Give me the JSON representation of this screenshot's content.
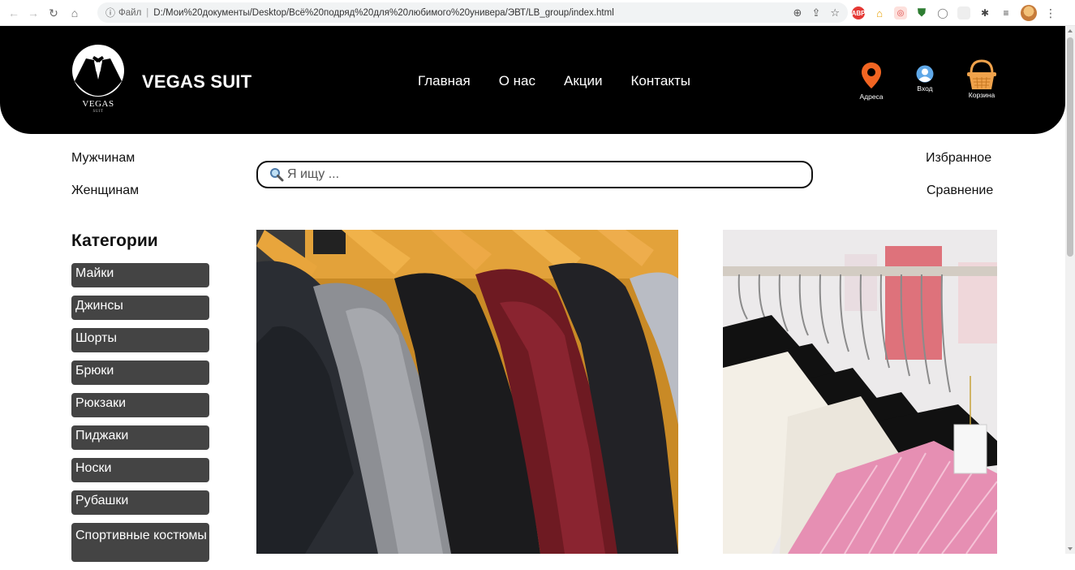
{
  "browser": {
    "scheme_label": "Файл",
    "url": "D:/Мои%20документы/Desktop/Всё%20подряд%20для%20любимого%20универа/ЭВТ/LB_group/index.html"
  },
  "site": {
    "logo_word": "VEGAS",
    "logo_sub": "SUIT",
    "brand": "VEGAS SUIT",
    "nav": [
      {
        "label": "Главная"
      },
      {
        "label": "О нас"
      },
      {
        "label": "Акции"
      },
      {
        "label": "Контакты"
      }
    ],
    "header_icons": {
      "address_label": "Адреса",
      "login_label": "Вход",
      "cart_label": "Корзина"
    }
  },
  "subbar": {
    "men": "Мужчинам",
    "women": "Женщинам",
    "favorites": "Избранное",
    "compare": "Сравнение",
    "search_placeholder": "Я ищу ..."
  },
  "categories": {
    "title": "Категории",
    "items": [
      {
        "label": "Майки"
      },
      {
        "label": "Джинсы"
      },
      {
        "label": "Шорты"
      },
      {
        "label": "Брюки"
      },
      {
        "label": "Рюкзаки"
      },
      {
        "label": "Пиджаки"
      },
      {
        "label": "Носки"
      },
      {
        "label": "Рубашки"
      },
      {
        "label": "Спортивные костюмы"
      }
    ]
  },
  "colors": {
    "header_bg": "#000000",
    "category_bg": "#444444",
    "pin": "#f26522",
    "cart": "#f0a24b"
  }
}
